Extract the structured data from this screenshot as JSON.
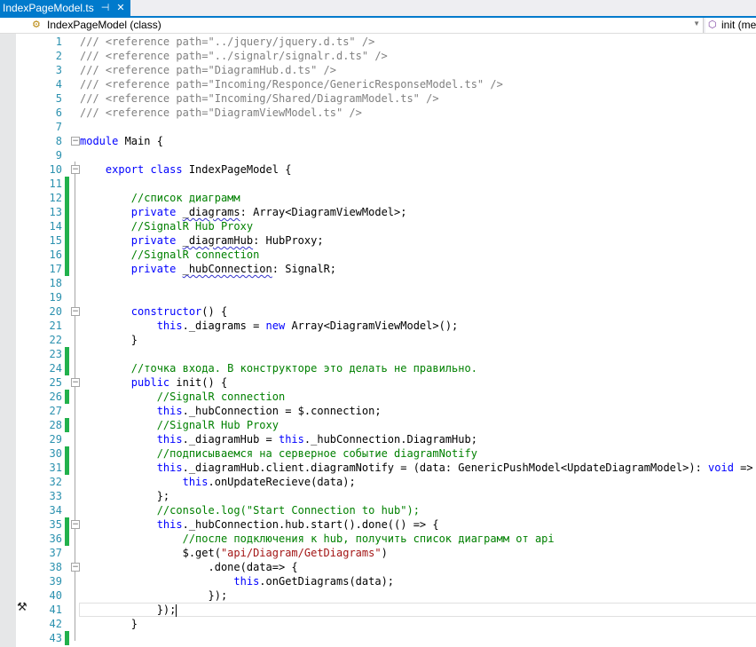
{
  "tab": {
    "title": "IndexPageModel.ts",
    "pin_icon": "pin-icon",
    "close_icon": "close-icon"
  },
  "navbar": {
    "type_label": "IndexPageModel (class)",
    "member_label": "init (met"
  },
  "colors": {
    "accent": "#007acc",
    "change_marker": "#22b14c",
    "keyword": "#0000ff",
    "comment": "#008000",
    "string": "#a31515",
    "line_number": "#2b91af"
  },
  "editor": {
    "current_line": 41,
    "changed_lines": [
      11,
      12,
      13,
      14,
      15,
      16,
      17,
      23,
      24,
      26,
      28,
      30,
      31,
      35,
      36,
      43
    ],
    "fold_lines": [
      8,
      10,
      20,
      25,
      35,
      38
    ],
    "lines": [
      [
        [
          "x",
          "/// <reference path=\"../jquery/jquery.d.ts\" />"
        ]
      ],
      [
        [
          "x",
          "/// <reference path=\"../signalr/signalr.d.ts\" />"
        ]
      ],
      [
        [
          "x",
          "/// <reference path=\"DiagramHub.d.ts\" />"
        ]
      ],
      [
        [
          "x",
          "/// <reference path=\"Incoming/Responce/GenericResponseModel.ts\" />"
        ]
      ],
      [
        [
          "x",
          "/// <reference path=\"Incoming/Shared/DiagramModel.ts\" />"
        ]
      ],
      [
        [
          "x",
          "/// <reference path=\"DiagramViewModel.ts\" />"
        ]
      ],
      [],
      [
        [
          "k",
          "module"
        ],
        [
          "p",
          " Main {"
        ]
      ],
      [],
      [
        [
          "p",
          "    "
        ],
        [
          "k",
          "export class"
        ],
        [
          "p",
          " IndexPageModel {"
        ]
      ],
      [],
      [
        [
          "p",
          "        "
        ],
        [
          "c",
          "//список диаграмм"
        ]
      ],
      [
        [
          "p",
          "        "
        ],
        [
          "k",
          "private"
        ],
        [
          "p",
          " "
        ],
        [
          "u",
          "_diagrams"
        ],
        [
          "p",
          ": Array<DiagramViewModel>;"
        ]
      ],
      [
        [
          "p",
          "        "
        ],
        [
          "c",
          "//SignalR Hub Proxy"
        ]
      ],
      [
        [
          "p",
          "        "
        ],
        [
          "k",
          "private"
        ],
        [
          "p",
          " "
        ],
        [
          "u",
          "_diagramHub"
        ],
        [
          "p",
          ": HubProxy;"
        ]
      ],
      [
        [
          "p",
          "        "
        ],
        [
          "c",
          "//SignalR connection"
        ]
      ],
      [
        [
          "p",
          "        "
        ],
        [
          "k",
          "private"
        ],
        [
          "p",
          " "
        ],
        [
          "u",
          "_hubConnection"
        ],
        [
          "p",
          ": SignalR;"
        ]
      ],
      [],
      [],
      [
        [
          "p",
          "        "
        ],
        [
          "k",
          "constructor"
        ],
        [
          "p",
          "() {"
        ]
      ],
      [
        [
          "p",
          "            "
        ],
        [
          "k",
          "this"
        ],
        [
          "p",
          "._diagrams = "
        ],
        [
          "k",
          "new"
        ],
        [
          "p",
          " Array<DiagramViewModel>();"
        ]
      ],
      [
        [
          "p",
          "        }"
        ]
      ],
      [],
      [
        [
          "p",
          "        "
        ],
        [
          "c",
          "//точка входа. В конструкторе это делать не правильно."
        ]
      ],
      [
        [
          "p",
          "        "
        ],
        [
          "k",
          "public"
        ],
        [
          "p",
          " init() {"
        ]
      ],
      [
        [
          "p",
          "            "
        ],
        [
          "c",
          "//SignalR connection"
        ]
      ],
      [
        [
          "p",
          "            "
        ],
        [
          "k",
          "this"
        ],
        [
          "p",
          "._hubConnection = $.connection;"
        ]
      ],
      [
        [
          "p",
          "            "
        ],
        [
          "c",
          "//SignalR Hub Proxy"
        ]
      ],
      [
        [
          "p",
          "            "
        ],
        [
          "k",
          "this"
        ],
        [
          "p",
          "._diagramHub = "
        ],
        [
          "k",
          "this"
        ],
        [
          "p",
          "._hubConnection.DiagramHub;"
        ]
      ],
      [
        [
          "p",
          "            "
        ],
        [
          "c",
          "//подписываемся на серверное событие diagramNotify"
        ]
      ],
      [
        [
          "p",
          "            "
        ],
        [
          "k",
          "this"
        ],
        [
          "p",
          "._diagramHub.client.diagramNotify = (data: GenericPushModel<UpdateDiagramModel>): "
        ],
        [
          "k",
          "void"
        ],
        [
          "p",
          " => {"
        ]
      ],
      [
        [
          "p",
          "                "
        ],
        [
          "k",
          "this"
        ],
        [
          "p",
          ".onUpdateRecieve(data);"
        ]
      ],
      [
        [
          "p",
          "            };"
        ]
      ],
      [
        [
          "p",
          "            "
        ],
        [
          "c",
          "//console.log(\"Start Connection to hub\");"
        ]
      ],
      [
        [
          "p",
          "            "
        ],
        [
          "k",
          "this"
        ],
        [
          "p",
          "._hubConnection.hub.start().done(() => {"
        ]
      ],
      [
        [
          "p",
          "                "
        ],
        [
          "c",
          "//после подключения к hub, получить список диаграмм от api"
        ]
      ],
      [
        [
          "p",
          "                $.get("
        ],
        [
          "s",
          "\"api/Diagram/GetDiagrams\""
        ],
        [
          "p",
          ")"
        ]
      ],
      [
        [
          "p",
          "                    .done(data=> {"
        ]
      ],
      [
        [
          "p",
          "                        "
        ],
        [
          "k",
          "this"
        ],
        [
          "p",
          ".onGetDiagrams(data);"
        ]
      ],
      [
        [
          "p",
          "                    });"
        ]
      ],
      [
        [
          "p",
          "            });"
        ]
      ],
      [
        [
          "p",
          "        }"
        ]
      ],
      []
    ]
  }
}
